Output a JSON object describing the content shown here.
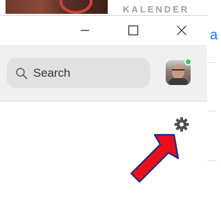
{
  "background": {
    "app_header_text": "KALENDER"
  },
  "window": {
    "controls": {
      "minimize": "minimize-icon",
      "maximize": "maximize-icon",
      "close": "close-icon"
    }
  },
  "search": {
    "label": "Search",
    "icon": "search-icon"
  },
  "profile": {
    "status_color": "#2ecc71",
    "status": "online"
  },
  "settings": {
    "icon": "gear-icon"
  },
  "annotation": {
    "arrow_color": "#e8101a",
    "arrow_outline": "#1c2a8a"
  },
  "partial_text": "a"
}
